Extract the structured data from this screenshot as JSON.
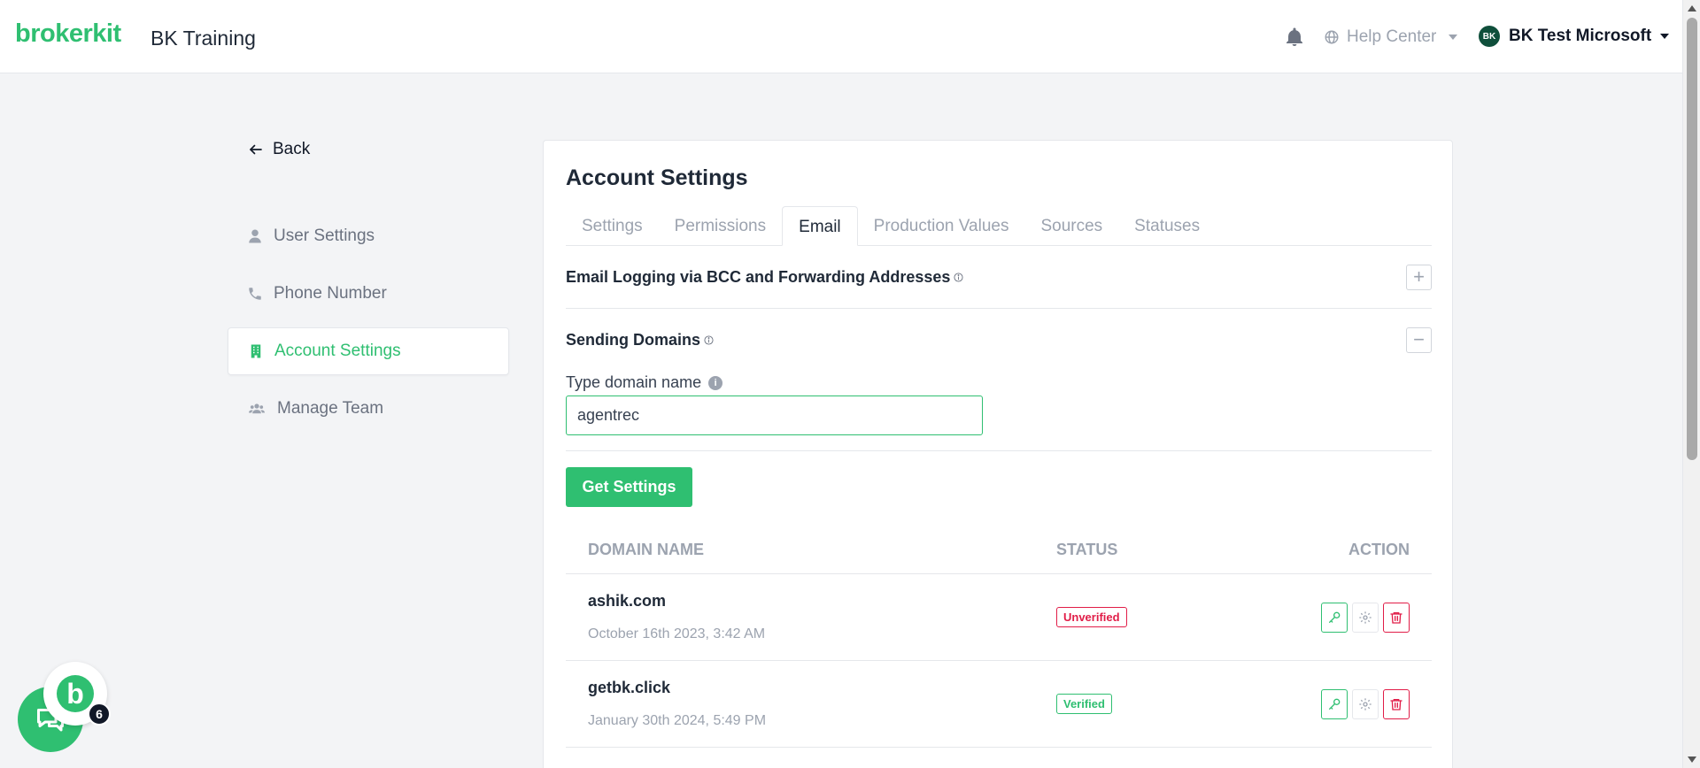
{
  "header": {
    "logo": "brokerkit",
    "workspace": "BK Training",
    "help_label": "Help Center",
    "user_initials": "BK",
    "user_name": "BK Test Microsoft"
  },
  "sidebar": {
    "back_label": "Back",
    "items": [
      {
        "label": "User Settings",
        "icon": "user-icon"
      },
      {
        "label": "Phone Number",
        "icon": "phone-icon"
      },
      {
        "label": "Account Settings",
        "icon": "building-icon",
        "active": true
      },
      {
        "label": "Manage Team",
        "icon": "users-icon"
      }
    ]
  },
  "card": {
    "title": "Account Settings",
    "tabs": [
      "Settings",
      "Permissions",
      "Email",
      "Production Values",
      "Sources",
      "Statuses"
    ],
    "active_tab": "Email"
  },
  "sections": {
    "email_logging_title": "Email Logging via BCC and Forwarding Addresses",
    "sending_domains_title": "Sending Domains",
    "expand_symbol": "+",
    "collapse_symbol": "−"
  },
  "form": {
    "domain_label": "Type domain name",
    "info_glyph": "i",
    "domain_value": "agentrec",
    "get_settings_label": "Get Settings"
  },
  "table": {
    "headers": {
      "domain": "DOMAIN NAME",
      "status": "STATUS",
      "action": "ACTION"
    },
    "rows": [
      {
        "domain": "ashik.com",
        "date": "October 16th 2023, 3:42 AM",
        "status": "Unverified"
      },
      {
        "domain": "getbk.click",
        "date": "January 30th 2024, 5:49 PM",
        "status": "Verified"
      }
    ]
  },
  "chat": {
    "bubble_letter": "b",
    "count": "6"
  },
  "colors": {
    "brand": "#2fbf71",
    "danger": "#e11d48",
    "muted": "#9ca3af"
  }
}
